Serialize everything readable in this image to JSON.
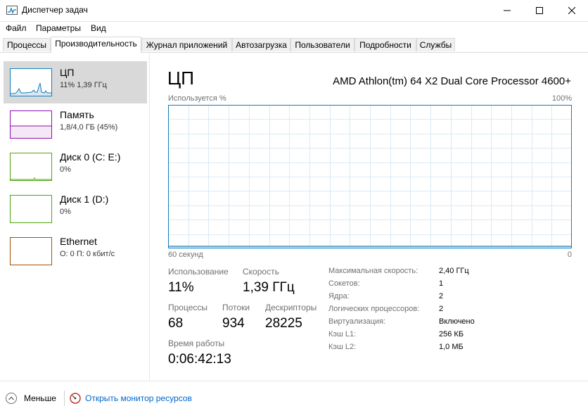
{
  "window": {
    "title": "Диспетчер задач",
    "accent": "#117dbb"
  },
  "menu": [
    "Файл",
    "Параметры",
    "Вид"
  ],
  "tabs": [
    {
      "label": "Процессы",
      "active": false
    },
    {
      "label": "Производительность",
      "active": true
    },
    {
      "label": "Журнал приложений",
      "active": false
    },
    {
      "label": "Автозагрузка",
      "active": false
    },
    {
      "label": "Пользователи",
      "active": false
    },
    {
      "label": "Подробности",
      "active": false
    },
    {
      "label": "Службы",
      "active": false
    }
  ],
  "sidebar": {
    "items": [
      {
        "name": "ЦП",
        "sub": "11% 1,39 ГГц",
        "color": "#117dbb",
        "selected": true
      },
      {
        "name": "Память",
        "sub": "1,8/4,0 ГБ (45%)",
        "color": "#8b12ae",
        "selected": false
      },
      {
        "name": "Диск 0 (C: E:)",
        "sub": "0%",
        "color": "#4da60c",
        "selected": false
      },
      {
        "name": "Диск 1 (D:)",
        "sub": "0%",
        "color": "#4da60c",
        "selected": false
      },
      {
        "name": "Ethernet",
        "sub": "О: 0 П: 0 кбит/с",
        "color": "#a74f01",
        "selected": false
      }
    ]
  },
  "main": {
    "title": "ЦП",
    "model": "AMD Athlon(tm) 64 X2 Dual Core Processor 4600+",
    "graph": {
      "top_left": "Используется %",
      "top_right": "100%",
      "bottom_left": "60 секунд",
      "bottom_right": "0"
    },
    "stats": {
      "usage_label": "Использование",
      "usage_value": "11%",
      "speed_label": "Скорость",
      "speed_value": "1,39 ГГц",
      "processes_label": "Процессы",
      "processes_value": "68",
      "threads_label": "Потоки",
      "threads_value": "934",
      "handles_label": "Дескрипторы",
      "handles_value": "28225",
      "uptime_label": "Время работы",
      "uptime_value": "0:06:42:13"
    },
    "details": [
      {
        "label": "Максимальная скорость:",
        "value": "2,40 ГГц"
      },
      {
        "label": "Сокетов:",
        "value": "1"
      },
      {
        "label": "Ядра:",
        "value": "2"
      },
      {
        "label": "Логических процессоров:",
        "value": "2"
      },
      {
        "label": "Виртуализация:",
        "value": "Включено"
      },
      {
        "label": "Кэш L1:",
        "value": "256 КБ"
      },
      {
        "label": "Кэш L2:",
        "value": "1,0 МБ"
      }
    ]
  },
  "footer": {
    "less_label": "Меньше",
    "monitor_label": "Открыть монитор ресурсов"
  },
  "chart_data": {
    "type": "area",
    "ylim": [
      0,
      100
    ],
    "x": [
      60,
      58,
      56,
      54,
      52,
      50,
      48,
      46,
      44,
      42,
      40,
      38,
      36,
      34,
      32,
      30,
      28,
      26,
      24,
      22,
      20,
      18,
      16,
      15,
      14,
      13,
      12,
      11,
      10,
      9,
      8,
      7,
      6,
      5,
      4,
      3,
      2,
      1,
      0
    ],
    "values": [
      1,
      1,
      1,
      1,
      1,
      1,
      1,
      1,
      1,
      1,
      1,
      1,
      1,
      1,
      1,
      1,
      1,
      1,
      1,
      1,
      1,
      1,
      1,
      1,
      1,
      1,
      1,
      1,
      1,
      1,
      1,
      1,
      1,
      1,
      1,
      1,
      1,
      1,
      1
    ]
  }
}
